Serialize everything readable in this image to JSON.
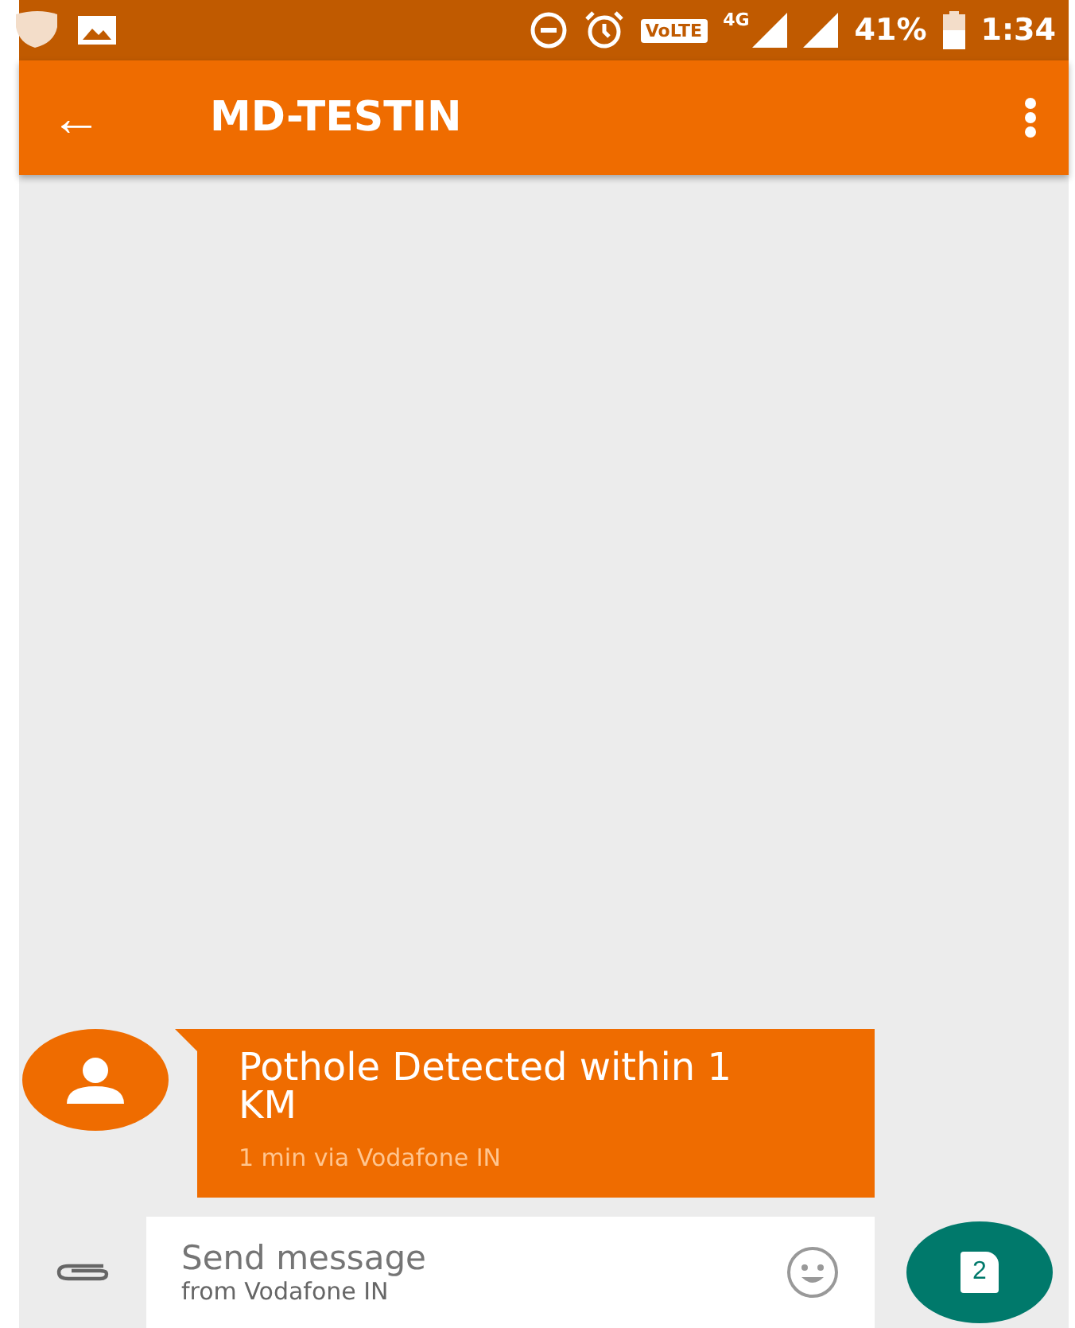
{
  "status_bar": {
    "volte": "VoLTE",
    "network": "4G",
    "battery_percent": "41%",
    "time": "1:34"
  },
  "toolbar": {
    "back": "←",
    "title": "MD-TESTIN"
  },
  "messages": [
    {
      "text": "Pothole Detected within 1 KM",
      "meta": "1 min via Vodafone IN"
    }
  ],
  "composer": {
    "placeholder": "Send message",
    "sub_placeholder": "from Vodafone IN",
    "sim": "2"
  }
}
